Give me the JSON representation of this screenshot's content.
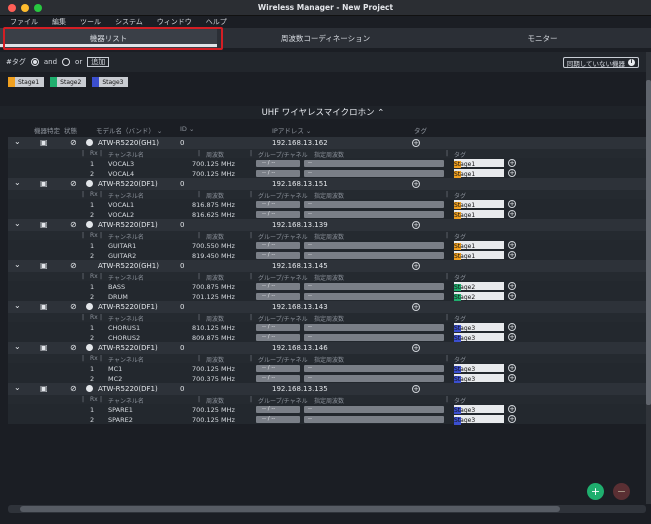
{
  "window": {
    "title": "Wireless Manager - New Project"
  },
  "menu": [
    "ファイル",
    "編集",
    "ツール",
    "システム",
    "ウィンドウ",
    "ヘルプ"
  ],
  "tabs": [
    "機器リスト",
    "周波数コーディネーション",
    "モニター"
  ],
  "tagbar": {
    "label": "#タグ",
    "and": "and",
    "or": "or",
    "add": "追加",
    "sync": "同期していない機器"
  },
  "stages": [
    {
      "label": "Stage1",
      "color": "#f0a020"
    },
    {
      "label": "Stage2",
      "color": "#1fae6e"
    },
    {
      "label": "Stage3",
      "color": "#3b4fd0"
    }
  ],
  "group": {
    "title": "UHF ワイヤレスマイクロホン"
  },
  "headers": {
    "ctrl": "機器特定",
    "status": "状態",
    "model": "モデル名（バンド）",
    "id": "ID",
    "ip": "IPアドレス",
    "tag": "タグ"
  },
  "subheaders": {
    "rx": "Rx",
    "channel": "チャンネル名",
    "freq": "周波数",
    "group": "グループ/チャネル",
    "spec": "指定周波数",
    "tag": "タグ"
  },
  "devices": [
    {
      "model": "ATW-R5220(GH1)",
      "id": "0",
      "ip": "192.168.13.162",
      "gear": true,
      "channels": [
        {
          "n": "1",
          "name": "VOCAL3",
          "freq": "700.125 MHz",
          "tag": "Stage1",
          "color": "#f0a020"
        },
        {
          "n": "2",
          "name": "VOCAL4",
          "freq": "700.125 MHz",
          "tag": "Stage1",
          "color": "#f0a020"
        }
      ]
    },
    {
      "model": "ATW-R5220(DF1)",
      "id": "0",
      "ip": "192.168.13.151",
      "gear": true,
      "channels": [
        {
          "n": "1",
          "name": "VOCAL1",
          "freq": "816.875 MHz",
          "tag": "Stage1",
          "color": "#f0a020"
        },
        {
          "n": "2",
          "name": "VOCAL2",
          "freq": "816.625 MHz",
          "tag": "Stage1",
          "color": "#f0a020"
        }
      ]
    },
    {
      "model": "ATW-R5220(DF1)",
      "id": "0",
      "ip": "192.168.13.139",
      "gear": true,
      "channels": [
        {
          "n": "1",
          "name": "GUITAR1",
          "freq": "700.550 MHz",
          "tag": "Stage1",
          "color": "#f0a020"
        },
        {
          "n": "2",
          "name": "GUITAR2",
          "freq": "819.450 MHz",
          "tag": "Stage1",
          "color": "#f0a020"
        }
      ]
    },
    {
      "model": "ATW-R5220(GH1)",
      "id": "0",
      "ip": "192.168.13.145",
      "gear": false,
      "channels": [
        {
          "n": "1",
          "name": "BASS",
          "freq": "700.875 MHz",
          "tag": "Stage2",
          "color": "#1fae6e"
        },
        {
          "n": "2",
          "name": "DRUM",
          "freq": "701.125 MHz",
          "tag": "Stage2",
          "color": "#1fae6e"
        }
      ]
    },
    {
      "model": "ATW-R5220(DF1)",
      "id": "0",
      "ip": "192.168.13.143",
      "gear": true,
      "channels": [
        {
          "n": "1",
          "name": "CHORUS1",
          "freq": "810.125 MHz",
          "tag": "Stage3",
          "color": "#3b4fd0"
        },
        {
          "n": "2",
          "name": "CHORUS2",
          "freq": "809.875 MHz",
          "tag": "Stage3",
          "color": "#3b4fd0"
        }
      ]
    },
    {
      "model": "ATW-R5220(DF1)",
      "id": "0",
      "ip": "192.168.13.146",
      "gear": true,
      "channels": [
        {
          "n": "1",
          "name": "MC1",
          "freq": "700.125 MHz",
          "tag": "Stage3",
          "color": "#3b4fd0"
        },
        {
          "n": "2",
          "name": "MC2",
          "freq": "700.375 MHz",
          "tag": "Stage3",
          "color": "#3b4fd0"
        }
      ]
    },
    {
      "model": "ATW-R5220(DF1)",
      "id": "0",
      "ip": "192.168.13.135",
      "gear": true,
      "channels": [
        {
          "n": "1",
          "name": "SPARE1",
          "freq": "700.125 MHz",
          "tag": "Stage3",
          "color": "#3b4fd0"
        },
        {
          "n": "2",
          "name": "SPARE2",
          "freq": "700.125 MHz",
          "tag": "Stage3",
          "color": "#3b4fd0"
        }
      ]
    }
  ],
  "group_value": "--  /  --",
  "spec_value": "--"
}
